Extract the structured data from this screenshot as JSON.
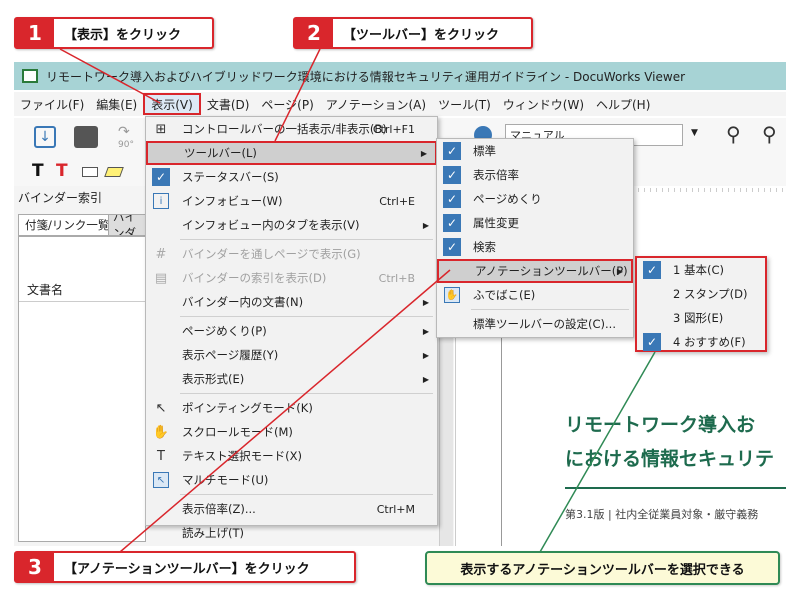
{
  "steps": [
    {
      "num": "1",
      "text": "【表示】をクリック"
    },
    {
      "num": "2",
      "text": "【ツールバー】をクリック"
    },
    {
      "num": "3",
      "text": "【アノテーションツールバー】をクリック"
    }
  ],
  "note": "表示するアノテーションツールバーを選択できる",
  "window": {
    "title": "リモートワーク導入およびハイブリッドワーク環境における情報セキュリティ運用ガイドライン - DocuWorks Viewer"
  },
  "menubar": [
    "ファイル(F)",
    "編集(E)",
    "表示(V)",
    "文書(D)",
    "ページ(P)",
    "アノテーション(A)",
    "ツール(T)",
    "ウィンドウ(W)",
    "ヘルプ(H)"
  ],
  "toolbar": {
    "zoom_label": "90°",
    "combo_value": "マニュアル"
  },
  "left_panel": {
    "binder_index": "バインダー索引",
    "tab1": "付箋/リンク一覧",
    "tab2": "バインダ",
    "column": "文書名"
  },
  "view_menu": {
    "items": [
      {
        "label": "コントロールバーの一括表示/非表示(B)",
        "shortcut": "Ctrl+F1"
      },
      {
        "label": "ツールバー(L)"
      },
      {
        "label": "ステータスバー(S)"
      },
      {
        "label": "インフォビュー(W)",
        "shortcut": "Ctrl+E"
      },
      {
        "label": "インフォビュー内のタブを表示(V)"
      },
      {
        "label": "バインダーを通しページで表示(G)"
      },
      {
        "label": "バインダーの索引を表示(D)",
        "shortcut": "Ctrl+B"
      },
      {
        "label": "バインダー内の文書(N)"
      },
      {
        "label": "ページめくり(P)"
      },
      {
        "label": "表示ページ履歴(Y)"
      },
      {
        "label": "表示形式(E)"
      },
      {
        "label": "ポインティングモード(K)"
      },
      {
        "label": "スクロールモード(M)"
      },
      {
        "label": "テキスト選択モード(X)"
      },
      {
        "label": "マルチモード(U)"
      },
      {
        "label": "表示倍率(Z)...",
        "shortcut": "Ctrl+M"
      },
      {
        "label": "読み上げ(T)"
      }
    ]
  },
  "toolbar_menu": {
    "items": [
      {
        "label": "標準"
      },
      {
        "label": "表示倍率"
      },
      {
        "label": "ページめくり"
      },
      {
        "label": "属性変更"
      },
      {
        "label": "検索"
      },
      {
        "label": "アノテーションツールバー(P)"
      },
      {
        "label": "ふでばこ(E)"
      },
      {
        "label": "標準ツールバーの設定(C)..."
      }
    ]
  },
  "annotation_menu": {
    "items": [
      {
        "label": "1 基本(C)"
      },
      {
        "label": "2 スタンプ(D)"
      },
      {
        "label": "3 図形(E)"
      },
      {
        "label": "4 おすすめ(F)"
      }
    ]
  },
  "document": {
    "title_line1": "リモートワーク導入お",
    "title_line2": "における情報セキュリテ",
    "subtitle": "第3.1版 | 社内全従業員対象・厳守義務"
  },
  "colors": {
    "accent_red": "#d9262c",
    "note_green": "#2f8a55",
    "title_bar": "#a7d3d5",
    "check_blue": "#3a78b6"
  }
}
